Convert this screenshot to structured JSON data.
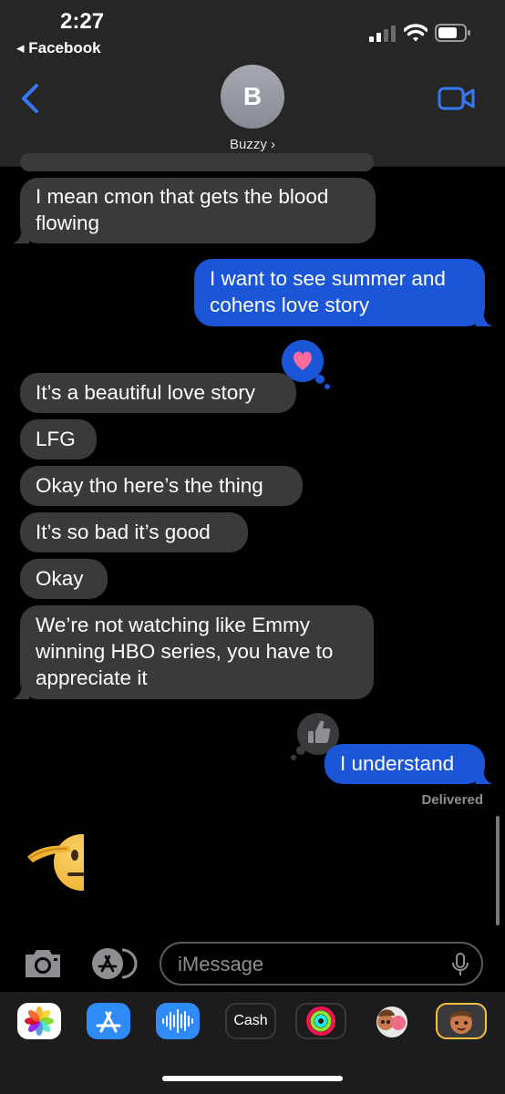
{
  "status_bar": {
    "time": "2:27",
    "back_app": "◂ Facebook"
  },
  "header": {
    "avatar_initial": "B",
    "contact_name": "Buzzy ›"
  },
  "messages": [
    {
      "side": "received",
      "lines": [
        "I mean cmon that gets the blood",
        "flowing"
      ]
    },
    {
      "side": "sent",
      "lines": [
        "I want to see summer and",
        "cohens love story"
      ]
    },
    {
      "side": "received",
      "lines": [
        "It’s a beautiful love story"
      ],
      "tapback": "heart-icon"
    },
    {
      "side": "received",
      "lines": [
        "LFG"
      ]
    },
    {
      "side": "received",
      "lines": [
        "Okay tho here’s the thing"
      ]
    },
    {
      "side": "received",
      "lines": [
        "It’s so bad it’s good"
      ]
    },
    {
      "side": "received",
      "lines": [
        "Okay"
      ]
    },
    {
      "side": "received",
      "lines": [
        "We’re not watching like Emmy",
        "winning HBO series, you have to",
        "appreciate it"
      ]
    },
    {
      "side": "sent",
      "lines": [
        "I understand"
      ],
      "tapback": "thumbs-up-icon"
    }
  ],
  "delivered_label": "Delivered",
  "emoji_message": "🫡",
  "input": {
    "placeholder": "iMessage"
  },
  "app_drawer": {
    "cash_label": "Cash",
    "apps": [
      "photos-icon",
      "app-store-icon",
      "audio-message-icon",
      "apple-cash-icon",
      "activity-icon",
      "memoji-stickers-icon",
      "memoji-icon"
    ]
  },
  "colors": {
    "sent_bubble": "#1b56d9",
    "received_bubble": "#3a3a3c",
    "accent": "#3478f6",
    "tapback_heart": "#ff6b9a"
  }
}
